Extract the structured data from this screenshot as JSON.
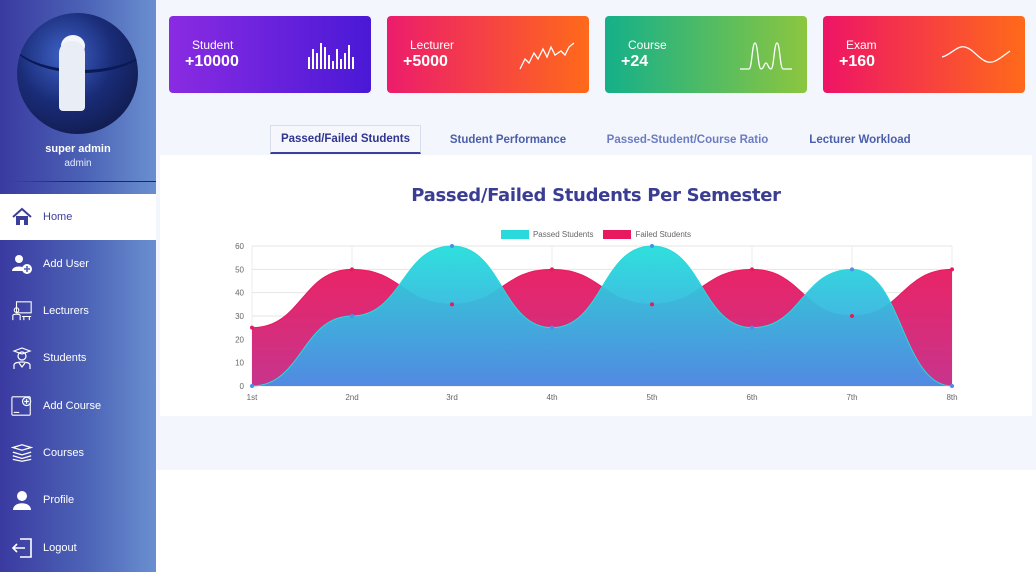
{
  "user": {
    "name": "super admin",
    "role": "admin"
  },
  "nav": {
    "items": [
      {
        "label": "Home",
        "icon": "home-icon"
      },
      {
        "label": "Add User",
        "icon": "add-user-icon"
      },
      {
        "label": "Lecturers",
        "icon": "lecturers-icon"
      },
      {
        "label": "Students",
        "icon": "students-icon"
      },
      {
        "label": "Add Course",
        "icon": "add-course-icon"
      },
      {
        "label": "Courses",
        "icon": "courses-icon"
      },
      {
        "label": "Profile",
        "icon": "profile-icon"
      },
      {
        "label": "Logout",
        "icon": "logout-icon"
      }
    ],
    "active": "Home"
  },
  "cards": [
    {
      "label": "Student",
      "value": "+10000",
      "gradient": [
        "#8a2be2",
        "#4a19d6"
      ],
      "sparkline": "bars-icon"
    },
    {
      "label": "Lecturer",
      "value": "+5000",
      "gradient": [
        "#ec1c6c",
        "#ff6a1a"
      ],
      "sparkline": "zigzag-icon"
    },
    {
      "label": "Course",
      "value": "+24",
      "gradient": [
        "#14b08a",
        "#8cc63f"
      ],
      "sparkline": "peaks-icon"
    },
    {
      "label": "Exam",
      "value": "+160",
      "gradient": [
        "#ee1466",
        "#ff6a1a"
      ],
      "sparkline": "wave-icon"
    }
  ],
  "tabs": [
    {
      "label": "Passed/Failed Students"
    },
    {
      "label": "Student Performance"
    },
    {
      "label": "Passed-Student/Course Ratio"
    },
    {
      "label": "Lecturer Workload"
    }
  ],
  "chart_data": {
    "type": "area",
    "title": "Passed/Failed Students Per Semester",
    "categories": [
      "1st",
      "2nd",
      "3rd",
      "4th",
      "5th",
      "6th",
      "7th",
      "8th"
    ],
    "series": [
      {
        "name": "Passed Students",
        "values": [
          0,
          30,
          60,
          25,
          60,
          25,
          50,
          0
        ],
        "color": "#29d9dc"
      },
      {
        "name": "Failed Students",
        "values": [
          25,
          50,
          35,
          50,
          35,
          50,
          30,
          50
        ],
        "color": "#e8195f"
      }
    ],
    "ylim": [
      0,
      60
    ],
    "yticks": [
      0,
      10,
      20,
      30,
      40,
      50,
      60
    ],
    "grid": true,
    "legend": "top-center"
  }
}
